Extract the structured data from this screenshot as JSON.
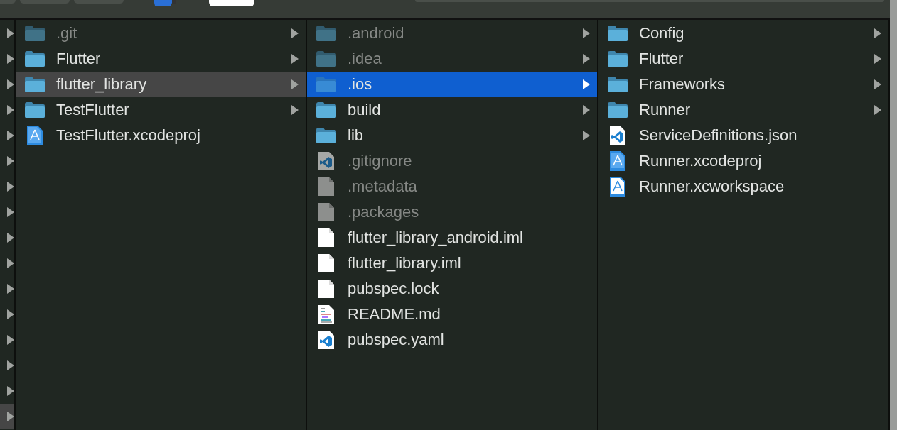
{
  "toolbar": {
    "buttons": [
      {
        "kind": "plain"
      },
      {
        "kind": "plain"
      },
      {
        "kind": "plain"
      },
      {
        "kind": "app"
      },
      {
        "kind": "pill"
      },
      {
        "kind": "search"
      }
    ]
  },
  "columns": [
    {
      "focused": false,
      "items": [
        {
          "has_children": true,
          "selected": false
        },
        {
          "has_children": true,
          "selected": false
        },
        {
          "has_children": true,
          "selected": false
        },
        {
          "has_children": true,
          "selected": false
        },
        {
          "has_children": true,
          "selected": false
        },
        {
          "has_children": true,
          "selected": false
        },
        {
          "has_children": true,
          "selected": false
        },
        {
          "has_children": true,
          "selected": false
        },
        {
          "has_children": true,
          "selected": false
        },
        {
          "has_children": true,
          "selected": false
        },
        {
          "has_children": true,
          "selected": false
        },
        {
          "has_children": true,
          "selected": false
        },
        {
          "has_children": true,
          "selected": false
        },
        {
          "has_children": true,
          "selected": false
        },
        {
          "has_children": true,
          "selected": false
        },
        {
          "has_children": true,
          "selected": true
        }
      ]
    },
    {
      "focused": false,
      "items": [
        {
          "name": ".git",
          "kind": "folder",
          "hidden": true,
          "has_children": true,
          "selected": false
        },
        {
          "name": "Flutter",
          "kind": "folder",
          "hidden": false,
          "has_children": true,
          "selected": false
        },
        {
          "name": "flutter_library",
          "kind": "folder",
          "hidden": false,
          "has_children": true,
          "selected": true
        },
        {
          "name": "TestFlutter",
          "kind": "folder",
          "hidden": false,
          "has_children": true,
          "selected": false
        },
        {
          "name": "TestFlutter.xcodeproj",
          "kind": "xcode",
          "hidden": false,
          "has_children": false,
          "selected": false
        }
      ]
    },
    {
      "focused": true,
      "items": [
        {
          "name": ".android",
          "kind": "folder",
          "hidden": true,
          "has_children": true,
          "selected": false
        },
        {
          "name": ".idea",
          "kind": "folder",
          "hidden": true,
          "has_children": true,
          "selected": false
        },
        {
          "name": ".ios",
          "kind": "folder",
          "hidden": true,
          "has_children": true,
          "selected": true
        },
        {
          "name": "build",
          "kind": "folder",
          "hidden": false,
          "has_children": true,
          "selected": false
        },
        {
          "name": "lib",
          "kind": "folder",
          "hidden": false,
          "has_children": true,
          "selected": false
        },
        {
          "name": ".gitignore",
          "kind": "vscode",
          "hidden": true,
          "has_children": false,
          "selected": false
        },
        {
          "name": ".metadata",
          "kind": "plain",
          "hidden": true,
          "has_children": false,
          "selected": false
        },
        {
          "name": ".packages",
          "kind": "plain",
          "hidden": true,
          "has_children": false,
          "selected": false
        },
        {
          "name": "flutter_library_android.iml",
          "kind": "plain",
          "hidden": false,
          "has_children": false,
          "selected": false
        },
        {
          "name": "flutter_library.iml",
          "kind": "plain",
          "hidden": false,
          "has_children": false,
          "selected": false
        },
        {
          "name": "pubspec.lock",
          "kind": "plain",
          "hidden": false,
          "has_children": false,
          "selected": false
        },
        {
          "name": "README.md",
          "kind": "markdown",
          "hidden": false,
          "has_children": false,
          "selected": false
        },
        {
          "name": "pubspec.yaml",
          "kind": "vscode",
          "hidden": false,
          "has_children": false,
          "selected": false
        }
      ]
    },
    {
      "items": [
        {
          "name": "Config",
          "kind": "folder",
          "hidden": false,
          "has_children": true,
          "selected": false
        },
        {
          "name": "Flutter",
          "kind": "folder",
          "hidden": false,
          "has_children": true,
          "selected": false
        },
        {
          "name": "Frameworks",
          "kind": "folder",
          "hidden": false,
          "has_children": true,
          "selected": false
        },
        {
          "name": "Runner",
          "kind": "folder",
          "hidden": false,
          "has_children": true,
          "selected": false
        },
        {
          "name": "ServiceDefinitions.json",
          "kind": "vscode",
          "hidden": false,
          "has_children": false,
          "selected": false
        },
        {
          "name": "Runner.xcodeproj",
          "kind": "xcode",
          "hidden": false,
          "has_children": false,
          "selected": false
        },
        {
          "name": "Runner.xcworkspace",
          "kind": "workspace",
          "hidden": false,
          "has_children": false,
          "selected": false
        }
      ]
    }
  ]
}
